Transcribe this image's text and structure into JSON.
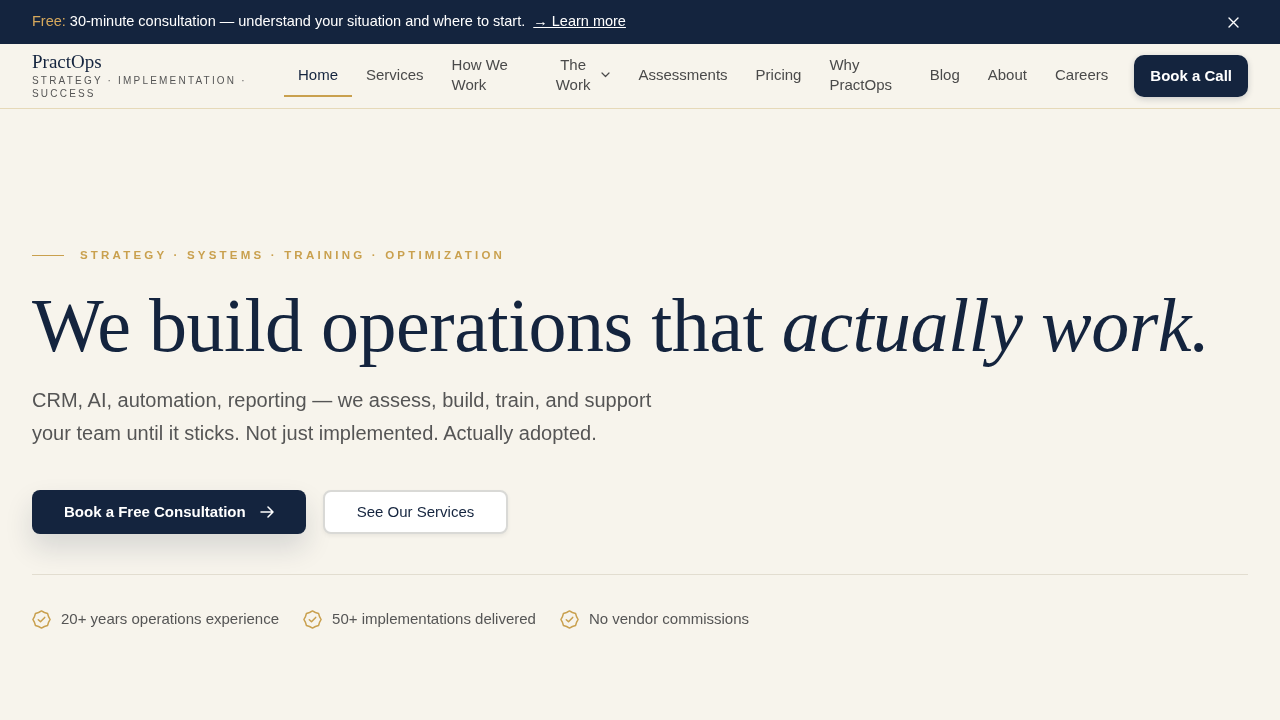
{
  "banner": {
    "label": "Free:",
    "text": "30-minute consultation — understand your situation and where to start.",
    "link": "→ Learn more"
  },
  "header": {
    "logo": {
      "name": "PractOps",
      "tagline": "STRATEGY · IMPLEMENTATION · SUCCESS"
    },
    "nav": [
      {
        "label": "Home",
        "kind": "link",
        "selected": true
      },
      {
        "label": "Services",
        "kind": "link",
        "selected": false
      },
      {
        "label": "How We Work",
        "kind": "link",
        "selected": false
      },
      {
        "label": "The Work",
        "kind": "dropdown",
        "selected": false
      },
      {
        "label": "Assessments",
        "kind": "link",
        "selected": false
      },
      {
        "label": "Pricing",
        "kind": "link",
        "selected": false
      },
      {
        "label": "Why PractOps",
        "kind": "link",
        "selected": false
      },
      {
        "label": "Blog",
        "kind": "link",
        "selected": false
      },
      {
        "label": "About",
        "kind": "link",
        "selected": false
      },
      {
        "label": "Careers",
        "kind": "link",
        "selected": false
      }
    ],
    "cta": "Book a Call"
  },
  "hero": {
    "eyebrow": "STRATEGY · SYSTEMS · TRAINING · OPTIMIZATION",
    "headline": "We build operations that *actually work.*",
    "subtitle": "CRM, AI, automation, reporting — we assess, build, train, and support your team until it sticks. Not just implemented. Actually adopted.",
    "buttons": [
      {
        "label": "Book a Free Consultation",
        "kind": "primary"
      },
      {
        "label": "See Our Services",
        "kind": "secondary"
      }
    ],
    "highlights": [
      "20+ years operations experience",
      "50+ implementations delivered",
      "No vendor commissions"
    ]
  }
}
